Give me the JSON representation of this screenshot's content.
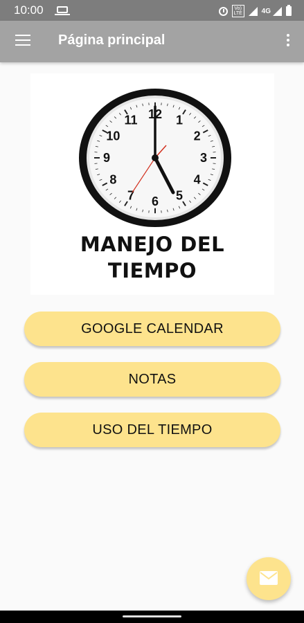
{
  "status_bar": {
    "time": "10:00",
    "volte_label": "Vo) LTE",
    "network_label": "4G",
    "icons": [
      "laptop-icon",
      "alarm-icon",
      "volte-icon",
      "signal-icon",
      "battery-icon"
    ]
  },
  "app_bar": {
    "title": "Página principal",
    "icons": [
      "menu-icon",
      "more-vert-icon"
    ]
  },
  "banner": {
    "line1": "MANEJO DEL",
    "line2": "TIEMPO",
    "clock_numbers": [
      "12",
      "1",
      "2",
      "3",
      "4",
      "5",
      "6",
      "7",
      "8",
      "9",
      "10",
      "11"
    ]
  },
  "buttons": {
    "google_calendar": "GOOGLE CALENDAR",
    "notas": "NOTAS",
    "uso_del_tiempo": "USO DEL TIEMPO"
  },
  "fab": {
    "icon": "mail-icon"
  },
  "colors": {
    "status_bar": "#7d7d7d",
    "app_bar": "#a3a3a3",
    "button": "#fde38d",
    "background": "#fafafa"
  }
}
